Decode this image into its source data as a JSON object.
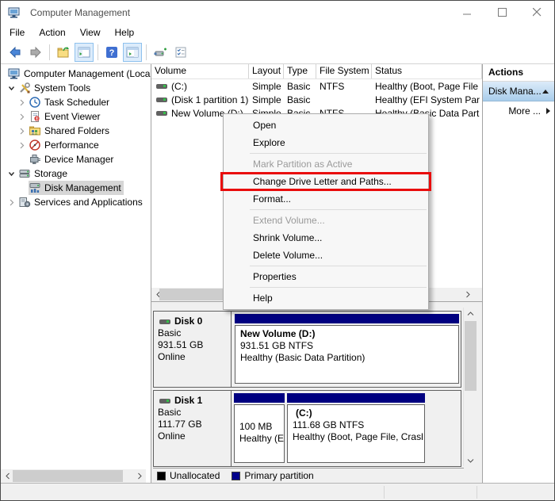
{
  "window": {
    "title": "Computer Management"
  },
  "accent_colors": {
    "partition_bar": "#000080",
    "annotation_red": "#e90c0c",
    "selection_gray": "#d6d6d6",
    "action_selected_blue": "#a8cdeb"
  },
  "menu_bar": {
    "items": [
      "File",
      "Action",
      "View",
      "Help"
    ]
  },
  "toolbar": {
    "icons": [
      "back-arrow-icon",
      "forward-arrow-icon",
      "up-level-folder-icon",
      "show-console-tree-icon",
      "help-icon",
      "show-action-pane-icon",
      "drive-plus-icon",
      "checklist-icon"
    ]
  },
  "sidebar": {
    "items": [
      {
        "label": "Computer Management (Loca",
        "icon": "computer-icon"
      },
      {
        "label": "System Tools",
        "icon": "system-tools-icon"
      },
      {
        "label": "Task Scheduler",
        "icon": "task-scheduler-icon"
      },
      {
        "label": "Event Viewer",
        "icon": "event-viewer-icon"
      },
      {
        "label": "Shared Folders",
        "icon": "shared-folders-icon"
      },
      {
        "label": "Performance",
        "icon": "performance-icon"
      },
      {
        "label": "Device Manager",
        "icon": "device-manager-icon"
      },
      {
        "label": "Storage",
        "icon": "storage-icon"
      },
      {
        "label": "Disk Management",
        "icon": "disk-management-icon",
        "selected": true
      },
      {
        "label": "Services and Applications",
        "icon": "services-icon"
      }
    ]
  },
  "volume_list": {
    "columns": [
      "Volume",
      "Layout",
      "Type",
      "File System",
      "Status"
    ],
    "rows": [
      {
        "volume": "(C:)",
        "layout": "Simple",
        "type": "Basic",
        "file_system": "NTFS",
        "status": "Healthy (Boot, Page File"
      },
      {
        "volume": "(Disk 1 partition 1)",
        "layout": "Simple",
        "type": "Basic",
        "file_system": "",
        "status": "Healthy (EFI System Par"
      },
      {
        "volume": "New Volume (D:)",
        "layout": "Simple",
        "type": "Basic",
        "file_system": "NTFS",
        "status": "Healthy (Basic Data Part"
      }
    ]
  },
  "context_menu": {
    "items": [
      {
        "label": "Open",
        "enabled": true
      },
      {
        "label": "Explore",
        "enabled": true
      },
      {
        "label": "Mark Partition as Active",
        "enabled": false
      },
      {
        "label": "Change Drive Letter and Paths...",
        "enabled": true,
        "annotated": true
      },
      {
        "label": "Format...",
        "enabled": true
      },
      {
        "label": "Extend Volume...",
        "enabled": false
      },
      {
        "label": "Shrink Volume...",
        "enabled": true
      },
      {
        "label": "Delete Volume...",
        "enabled": true
      },
      {
        "label": "Properties",
        "enabled": true
      },
      {
        "label": "Help",
        "enabled": true
      }
    ]
  },
  "actions": {
    "header": "Actions",
    "section": "Disk Mana...",
    "more": "More ..."
  },
  "graphical_view": {
    "disks": [
      {
        "name": "Disk 0",
        "kind": "Basic",
        "size": "931.51 GB",
        "state": "Online",
        "partitions": [
          {
            "title": "New Volume  (D:)",
            "size_line": "931.51 GB NTFS",
            "status_line": "Healthy (Basic Data Partition)"
          }
        ]
      },
      {
        "name": "Disk 1",
        "kind": "Basic",
        "size": "111.77 GB",
        "state": "Online",
        "partitions": [
          {
            "title": "",
            "size_line": "100 MB",
            "status_line": "Healthy (E"
          },
          {
            "title": "(C:)",
            "size_line": "111.68 GB NTFS",
            "status_line": "Healthy (Boot, Page File, Crasl"
          }
        ]
      }
    ],
    "legend": [
      {
        "label": "Unallocated",
        "color": "#000000"
      },
      {
        "label": "Primary partition",
        "color": "#00008b"
      }
    ]
  }
}
